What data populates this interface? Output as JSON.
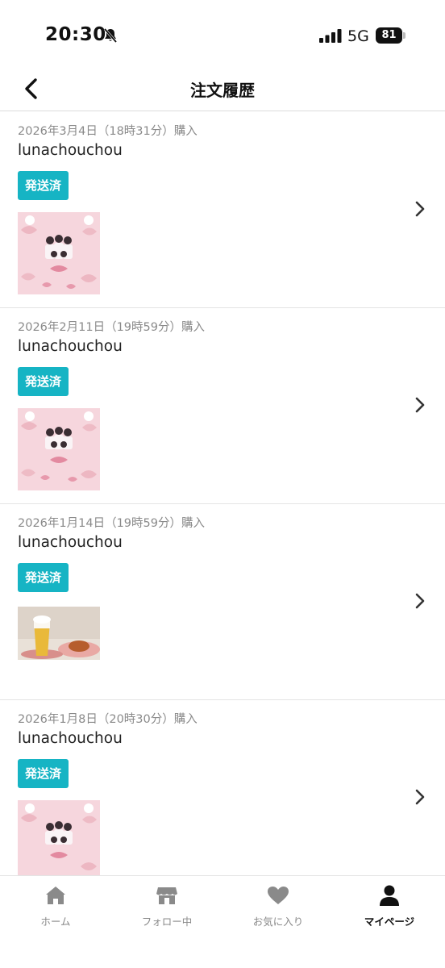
{
  "status_bar": {
    "time": "20:30",
    "network": "5G",
    "battery": "81"
  },
  "header": {
    "title": "注文履歴"
  },
  "orders": [
    {
      "date": "2026年3月4日（18時31分）購入",
      "shop": "lunachouchou",
      "status": "発送済"
    },
    {
      "date": "2026年2月11日（19時59分）購入",
      "shop": "lunachouchou",
      "status": "発送済"
    },
    {
      "date": "2026年1月14日（19時59分）購入",
      "shop": "lunachouchou",
      "status": "発送済"
    },
    {
      "date": "2026年1月8日（20時30分）購入",
      "shop": "lunachouchou",
      "status": "発送済"
    }
  ],
  "tabs": [
    {
      "label": "ホーム",
      "icon": "home-icon"
    },
    {
      "label": "フォロー中",
      "icon": "shop-icon"
    },
    {
      "label": "お気に入り",
      "icon": "heart-icon"
    },
    {
      "label": "マイページ",
      "icon": "person-icon"
    }
  ],
  "colors": {
    "badge": "#16b4c4",
    "accent_active": "#111111",
    "inactive": "#8a8a8a"
  }
}
